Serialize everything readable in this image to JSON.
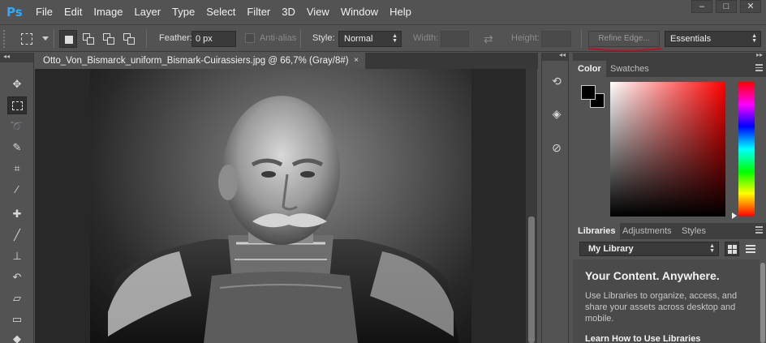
{
  "app": {
    "logo": "Ps"
  },
  "menu": [
    "File",
    "Edit",
    "Image",
    "Layer",
    "Type",
    "Select",
    "Filter",
    "3D",
    "View",
    "Window",
    "Help"
  ],
  "window_buttons": [
    "–",
    "□",
    "✕"
  ],
  "options": {
    "feather_label": "Feather:",
    "feather_value": "0 px",
    "antialias_label": "Anti-alias",
    "style_label": "Style:",
    "style_value": "Normal",
    "width_label": "Width:",
    "height_label": "Height:",
    "refine_edge_label": "Refine Edge...",
    "workspace_value": "Essentials"
  },
  "document": {
    "tab_title": "Otto_Von_Bismarck_uniform_Bismark-Cuirassiers.jpg @ 66,7% (Gray/8#)",
    "close_glyph": "×"
  },
  "color_panel": {
    "tabs": [
      "Color",
      "Swatches"
    ],
    "foreground": "#000000",
    "background": "#000000"
  },
  "libraries_panel": {
    "tabs": [
      "Libraries",
      "Adjustments",
      "Styles"
    ],
    "library_select": "My Library",
    "heading": "Your Content. Anywhere.",
    "description": "Use Libraries to organize, access, and share your assets across desktop and mobile.",
    "link": "Learn How to Use Libraries"
  },
  "icons": {
    "tools": [
      "move-icon",
      "marquee-icon",
      "lasso-icon",
      "quick-selection-icon",
      "crop-icon",
      "eyedropper-icon",
      "healing-brush-icon",
      "brush-icon",
      "clone-stamp-icon",
      "history-brush-icon",
      "eraser-icon",
      "gradient-icon",
      "blur-icon"
    ],
    "mini": [
      "history-icon",
      "3d-icon",
      "properties-icon"
    ]
  },
  "colors": {
    "accent": "#31a8ff",
    "annotation": "#d0021b"
  }
}
